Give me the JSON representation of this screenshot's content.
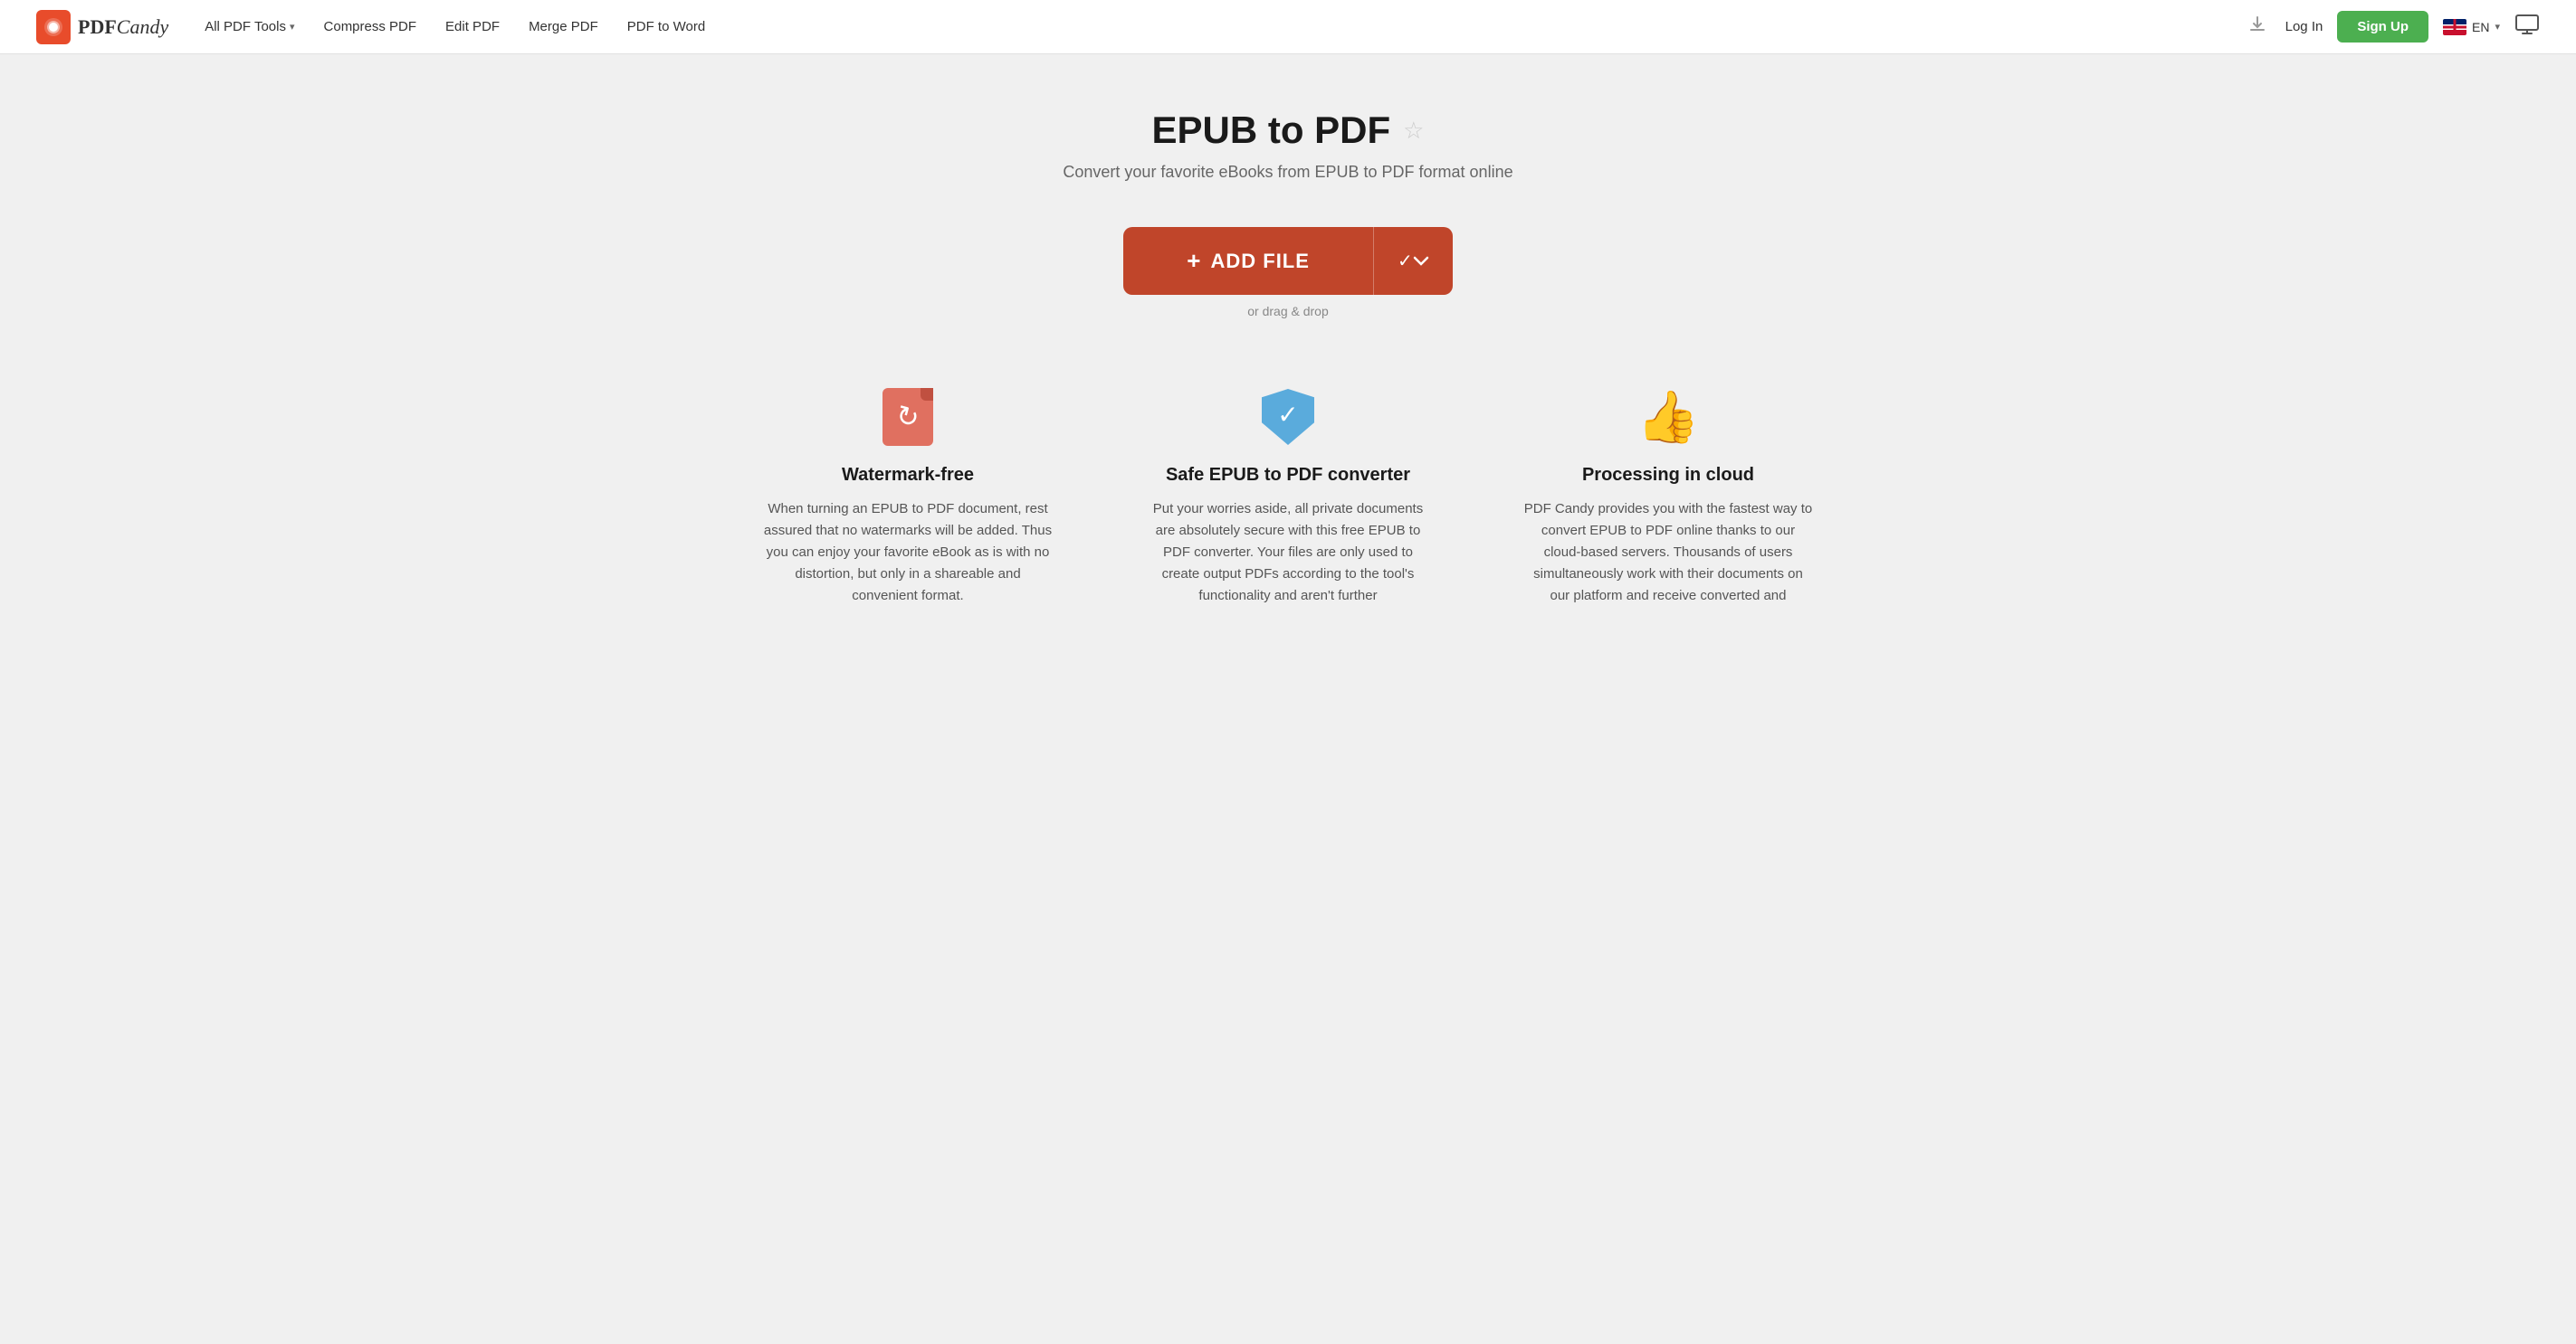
{
  "header": {
    "logo_text_bold": "PDF",
    "logo_text_italic": "Candy",
    "nav": [
      {
        "label": "All PDF Tools",
        "has_dropdown": true
      },
      {
        "label": "Compress PDF",
        "has_dropdown": false
      },
      {
        "label": "Edit PDF",
        "has_dropdown": false
      },
      {
        "label": "Merge PDF",
        "has_dropdown": false
      },
      {
        "label": "PDF to Word",
        "has_dropdown": false
      }
    ],
    "login_label": "Log In",
    "signup_label": "Sign Up",
    "lang_code": "EN",
    "lang_arrow": "▾"
  },
  "main": {
    "title": "EPUB to PDF",
    "subtitle": "Convert your favorite eBooks from EPUB to PDF format online",
    "add_file_label": "ADD FILE",
    "drag_drop_label": "or drag & drop"
  },
  "features": [
    {
      "id": "watermark-free",
      "title": "Watermark-free",
      "desc": "When turning an EPUB to PDF document, rest assured that no watermarks will be added. Thus you can enjoy your favorite eBook as is with no distortion, but only in a shareable and convenient format."
    },
    {
      "id": "safe-converter",
      "title": "Safe EPUB to PDF converter",
      "desc": "Put your worries aside, all private documents are absolutely secure with this free EPUB to PDF converter. Your files are only used to create output PDFs according to the tool's functionality and aren't further"
    },
    {
      "id": "cloud-processing",
      "title": "Processing in cloud",
      "desc": "PDF Candy provides you with the fastest way to convert EPUB to PDF online thanks to our cloud-based servers. Thousands of users simultaneously work with their documents on our platform and receive converted and"
    }
  ]
}
